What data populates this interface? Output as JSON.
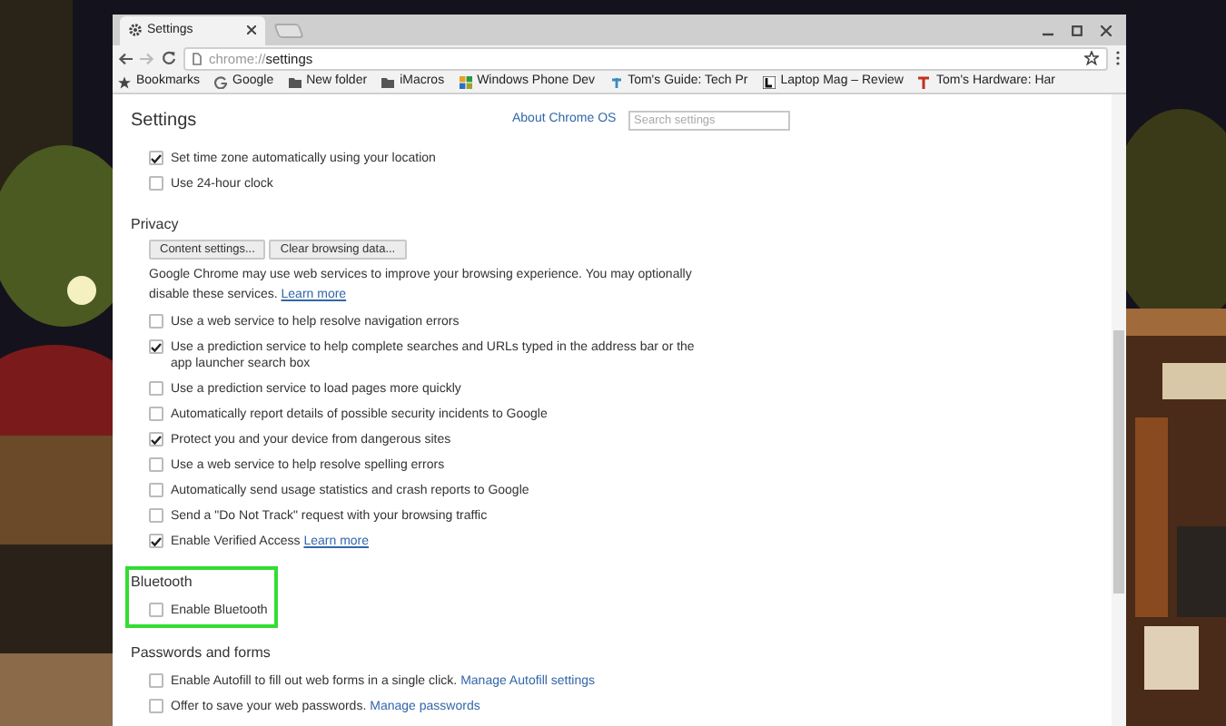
{
  "window": {
    "tabs": [
      {
        "title": "Settings",
        "selected": true
      }
    ]
  },
  "toolbar": {
    "url_scheme": "chrome://",
    "url_path": "settings"
  },
  "bookmarks": [
    {
      "label": "Bookmarks",
      "kind": "star"
    },
    {
      "label": "Google",
      "kind": "google"
    },
    {
      "label": "New folder",
      "kind": "folder"
    },
    {
      "label": "iMacros",
      "kind": "folder"
    },
    {
      "label": "Windows Phone Dev",
      "kind": "tiles"
    },
    {
      "label": "Tom's Guide: Tech Pr",
      "kind": "t"
    },
    {
      "label": "Laptop Mag – Review",
      "kind": "l"
    },
    {
      "label": "Tom's Hardware: Har",
      "kind": "tred"
    }
  ],
  "page": {
    "title": "Settings",
    "about_link": "About Chrome OS",
    "search": {
      "placeholder": "Search settings"
    }
  },
  "sections": [
    {
      "highlighted": false,
      "items": [
        {
          "kind": "checkbox",
          "label": "Set time zone automatically using your location",
          "checked": true
        },
        {
          "kind": "checkbox",
          "label": "Use 24-hour clock",
          "checked": false
        }
      ]
    },
    {
      "heading": "Privacy",
      "highlighted": false,
      "items": [
        {
          "kind": "buttons",
          "buttons": [
            "Content settings...",
            "Clear browsing data..."
          ]
        },
        {
          "kind": "paragraph",
          "label": "Google Chrome may use web services to improve your browsing experience. You may optionally disable these services.",
          "link": "Learn more"
        },
        {
          "kind": "checkbox",
          "label": "Use a web service to help resolve navigation errors",
          "checked": false
        },
        {
          "kind": "checkbox",
          "label": "Use a prediction service to help complete searches and URLs typed in the address bar or the app launcher search box",
          "checked": true
        },
        {
          "kind": "checkbox",
          "label": "Use a prediction service to load pages more quickly",
          "checked": false
        },
        {
          "kind": "checkbox",
          "label": "Automatically report details of possible security incidents to Google",
          "checked": false
        },
        {
          "kind": "checkbox",
          "label": "Protect you and your device from dangerous sites",
          "checked": true
        },
        {
          "kind": "checkbox",
          "label": "Use a web service to help resolve spelling errors",
          "checked": false
        },
        {
          "kind": "checkbox",
          "label": "Automatically send usage statistics and crash reports to Google",
          "checked": false
        },
        {
          "kind": "checkbox",
          "label": "Send a \"Do Not Track\" request with your browsing traffic",
          "checked": false
        },
        {
          "kind": "checkbox",
          "label": "Enable Verified Access",
          "link": "Learn more",
          "checked": true
        }
      ]
    },
    {
      "heading": "Bluetooth",
      "highlighted": true,
      "items": [
        {
          "kind": "checkbox",
          "label": "Enable Bluetooth",
          "checked": false
        }
      ]
    },
    {
      "heading": "Passwords and forms",
      "highlighted": false,
      "items": [
        {
          "kind": "checkbox",
          "label": "Enable Autofill to fill out web forms in a single click.",
          "link": "Manage Autofill settings",
          "checked": false
        },
        {
          "kind": "checkbox",
          "label": "Offer to save your web passwords.",
          "link": "Manage passwords",
          "checked": false
        }
      ]
    }
  ]
}
